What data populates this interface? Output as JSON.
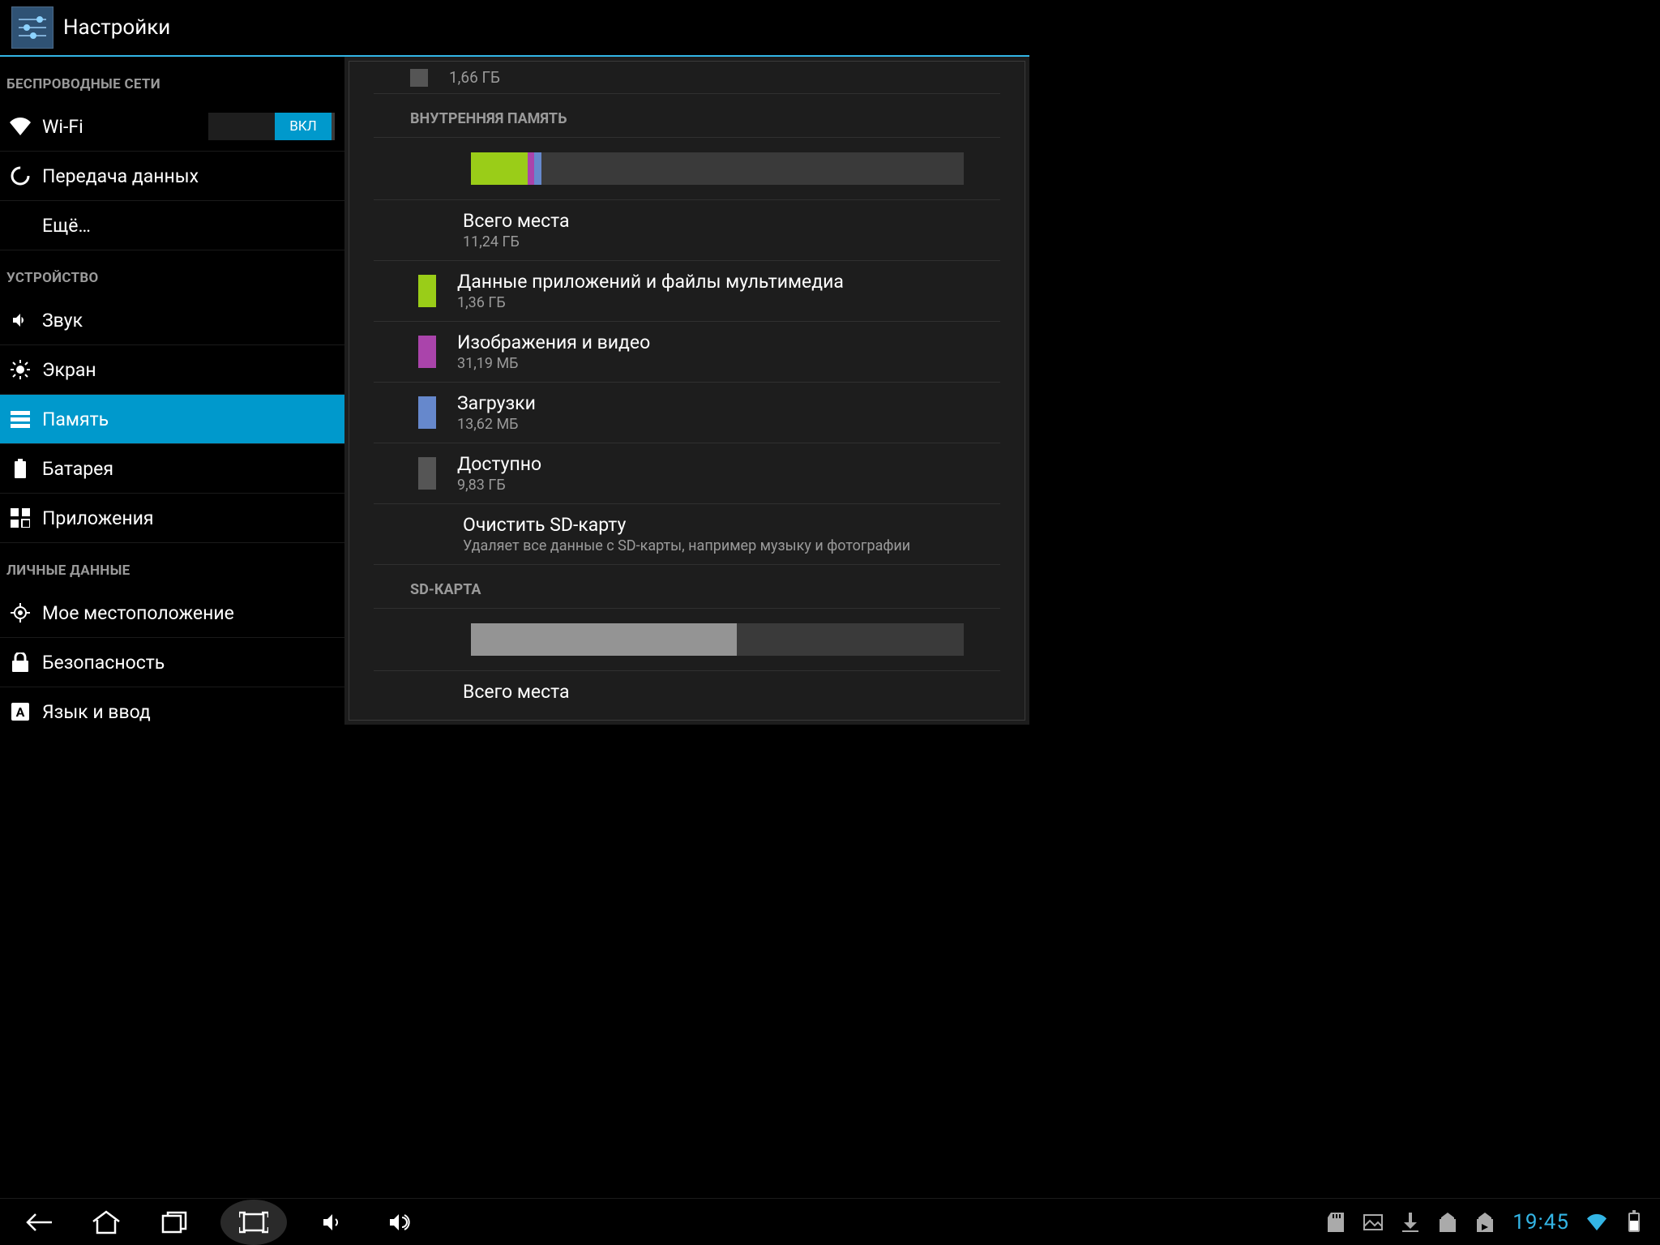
{
  "header": {
    "title": "Настройки"
  },
  "sidebar": {
    "cat_wireless": "БЕСПРОВОДНЫЕ СЕТИ",
    "wifi": "Wi-Fi",
    "wifi_toggle": "ВКЛ",
    "data": "Передача данных",
    "more": "Ещё…",
    "cat_device": "УСТРОЙСТВО",
    "sound": "Звук",
    "display": "Экран",
    "storage": "Память",
    "battery": "Батарея",
    "apps": "Приложения",
    "cat_personal": "ЛИЧНЫЕ ДАННЫЕ",
    "location": "Мое местоположение",
    "security": "Безопасность",
    "language": "Язык и ввод"
  },
  "detail": {
    "cut_value": "1,66 ГБ",
    "internal_header": "ВНУТРЕННЯЯ ПАМЯТЬ",
    "total": {
      "name": "Всего места",
      "val": "11,24 ГБ"
    },
    "apps": {
      "name": "Данные приложений и файлы мультимедиа",
      "val": "1,36 ГБ",
      "color": "#9acd18"
    },
    "media": {
      "name": "Изображения и видео",
      "val": "31,19 МБ",
      "color": "#aa44ab"
    },
    "downloads": {
      "name": "Загрузки",
      "val": "13,62 МБ",
      "color": "#6688cc"
    },
    "available": {
      "name": "Доступно",
      "val": "9,83 ГБ",
      "color": "#555555"
    },
    "erase": {
      "name": "Очистить SD-карту",
      "sub": "Удаляет все данные с SD-карты, например музыку и фотографии"
    },
    "sd_header": "SD-КАРТА",
    "sd_total": {
      "name": "Всего места"
    },
    "bar_segments": [
      {
        "color": "#9acd18",
        "pct": 11.5
      },
      {
        "color": "#aa44ab",
        "pct": 1.4
      },
      {
        "color": "#6688cc",
        "pct": 1.4
      }
    ],
    "sd_bar_pct": 54
  },
  "navbar": {
    "time": "19:45"
  }
}
